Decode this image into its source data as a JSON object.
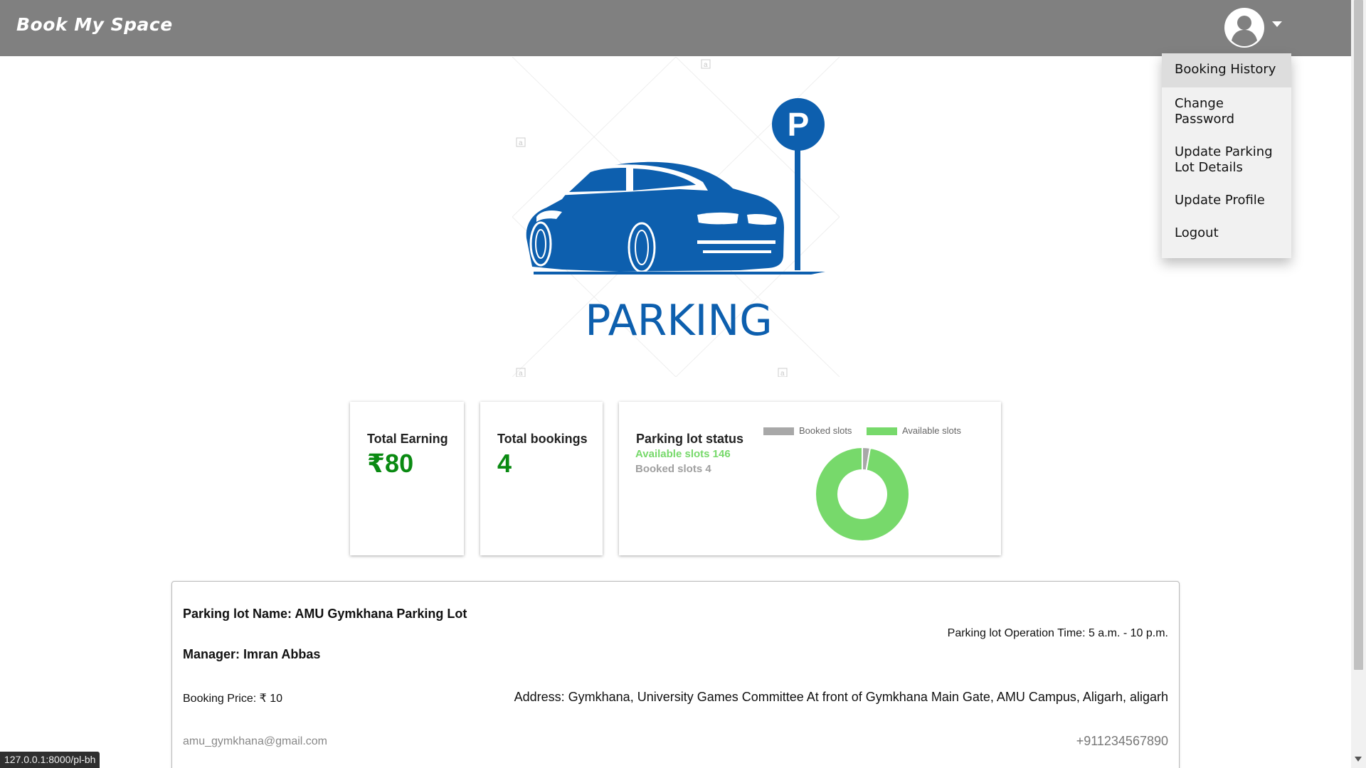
{
  "app": {
    "brand": "Book My Space"
  },
  "user_menu": {
    "items": [
      {
        "label": "Booking History"
      },
      {
        "label": "Change Password"
      },
      {
        "label": "Update Parking Lot Details"
      },
      {
        "label": "Update Profile"
      },
      {
        "label": "Logout"
      }
    ]
  },
  "hero": {
    "caption": "PARKING",
    "sign_letter": "P",
    "watermark_stamp": "a"
  },
  "stats": {
    "earning": {
      "title": "Total Earning",
      "value": "₹80"
    },
    "bookings": {
      "title": "Total bookings",
      "value": "4"
    },
    "status": {
      "title": "Parking lot status",
      "available_text": "Available slots 146",
      "booked_text": "Booked slots 4",
      "legend_booked": "Booked slots",
      "legend_available": "Available slots"
    }
  },
  "chart_data": {
    "type": "pie",
    "series": [
      {
        "name": "Booked slots",
        "value": 4,
        "color": "#a8a8a8"
      },
      {
        "name": "Available slots",
        "value": 146,
        "color": "#77d96b"
      }
    ],
    "legend": "top"
  },
  "details": {
    "name": "Parking lot Name: AMU Gymkhana Parking Lot",
    "operation_time": "Parking lot Operation Time: 5 a.m. - 10 p.m.",
    "manager": "Manager: Imran Abbas",
    "price": "Booking Price: ₹ 10",
    "address": "Address: Gymkhana, University Games Committee At front of Gymkhana Main Gate, AMU Campus, Aligarh, aligarh",
    "email": "amu_gymkhana@gmail.com",
    "phone": "+911234567890"
  },
  "statusbar": {
    "url": "127.0.0.1:8000/pl-bh"
  },
  "colors": {
    "navbar": "#808080",
    "brand_blue": "#0d5fae",
    "green": "#0a8a12",
    "available": "#77d96b",
    "booked": "#a8a8a8"
  }
}
